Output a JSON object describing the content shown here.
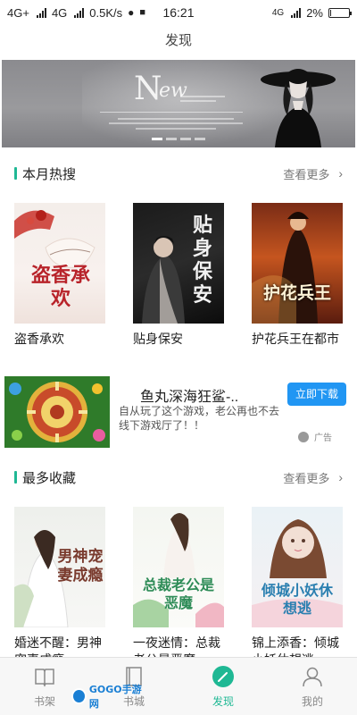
{
  "status_bar": {
    "network1": "4G+",
    "network2": "4G",
    "speed": "0.5K/s",
    "time": "16:21",
    "network_right": "4G",
    "battery": "2%",
    "battery_level": 0.02
  },
  "header": {
    "title": "发现"
  },
  "banner": {
    "big_letter": "N",
    "rest_letters": "ew",
    "active_dot": 0,
    "dot_count": 4
  },
  "sections": {
    "monthly_hot": {
      "title": "本月热搜",
      "more": "查看更多",
      "books": [
        {
          "title": "盗香承欢",
          "cover_text": "盗香承欢"
        },
        {
          "title": "贴身保安",
          "cover_text": "贴身保安"
        },
        {
          "title": "护花兵王在都市",
          "cover_text": "护花兵王"
        }
      ]
    },
    "most_favorited": {
      "title": "最多收藏",
      "more": "查看更多",
      "books": [
        {
          "title": "婚迷不醒：男神宠妻成瘾",
          "cover_text": "男神宠妻成瘾"
        },
        {
          "title": "一夜迷情：总裁老公是恶魔",
          "cover_text": "总裁老公是恶魔"
        },
        {
          "title": "锦上添香：倾城小妖休想逃",
          "cover_text": "倾城小妖休想逃"
        }
      ]
    }
  },
  "ad": {
    "title": "鱼丸深海狂鲨-..",
    "description": "自从玩了这个游戏，老公再也不去线下游戏厅了！！",
    "button": "立即下载",
    "label": "广告"
  },
  "bottom_nav": {
    "items": [
      {
        "label": "书架",
        "icon": "book-icon",
        "active": false
      },
      {
        "label": "书城",
        "icon": "bookstore-icon",
        "active": false
      },
      {
        "label": "发现",
        "icon": "compass-icon",
        "active": true
      },
      {
        "label": "我的",
        "icon": "person-icon",
        "active": false
      }
    ]
  },
  "watermark": {
    "text": "GOGO手游网"
  },
  "colors": {
    "accent": "#1fb894",
    "ad_button": "#2196f3"
  }
}
